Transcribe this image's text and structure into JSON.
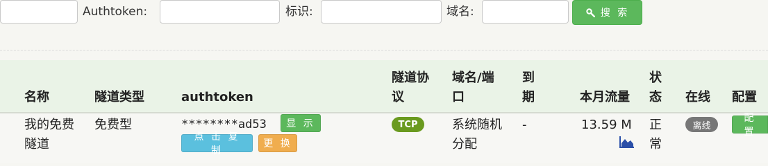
{
  "search": {
    "authtoken_label": "Authtoken:",
    "tag_label": "标识:",
    "domain_label": "域名:",
    "search_button_label": "搜 索",
    "authtoken_value": "",
    "tag_value": "",
    "domain_value": ""
  },
  "table": {
    "headers": {
      "name": "名称",
      "type": "隧道类型",
      "authtoken": "authtoken",
      "protocol_l1": "隧道协",
      "protocol_l2": "议",
      "domain_l1": "域名/端",
      "domain_l2": "口",
      "expire_l1": "到",
      "expire_l2": "期",
      "traffic": "本月流量",
      "status_l1": "状",
      "status_l2": "态",
      "online": "在线",
      "config": "配置"
    },
    "rows": [
      {
        "name_l1": "我的免费",
        "name_l2": "隧道",
        "type": "免费型",
        "authtoken": "********ad53",
        "show_label": "显 示",
        "copy_label": "点 击 复 制",
        "change_label": "更 换",
        "protocol": "TCP",
        "domain_l1": "系统随机",
        "domain_l2": "分配",
        "expire": "-",
        "traffic": "13.59 M",
        "status_l1": "正",
        "status_l2": "常",
        "online": "离线",
        "config_label": "配 置"
      }
    ]
  },
  "colors": {
    "success": "#5cb85c",
    "info": "#5bc0de",
    "warning": "#f0ad4e",
    "tcp_badge": "#6a9a1f",
    "offline_badge": "#777777",
    "chart_icon": "#2a4fa8"
  },
  "icons": {
    "search_button": "search-icon",
    "traffic_chart": "area-chart-icon"
  }
}
